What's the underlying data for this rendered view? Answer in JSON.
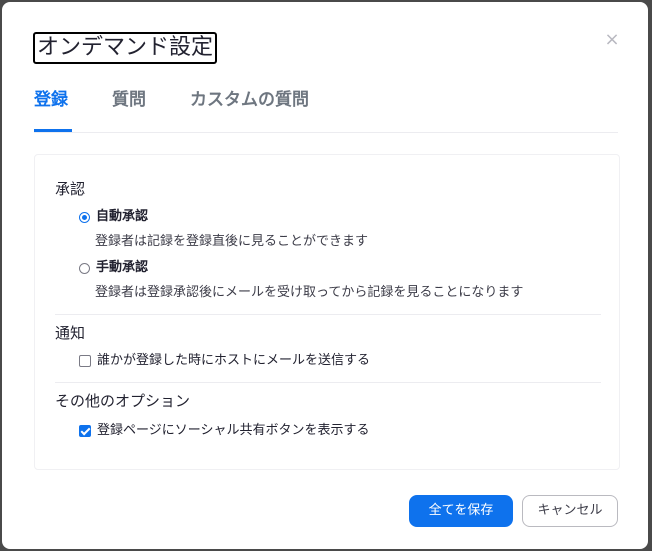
{
  "dialog": {
    "title": "オンデマンド設定",
    "close_glyph": "×"
  },
  "tabs": [
    {
      "label": "登録",
      "active": true
    },
    {
      "label": "質問",
      "active": false
    },
    {
      "label": "カスタムの質問",
      "active": false
    }
  ],
  "approval": {
    "title": "承認",
    "options": [
      {
        "label": "自動承認",
        "description": "登録者は記録を登録直後に見ることができます",
        "selected": true
      },
      {
        "label": "手動承認",
        "description": "登録者は登録承認後にメールを受け取ってから記録を見ることになります",
        "selected": false
      }
    ]
  },
  "notification": {
    "title": "通知",
    "options": [
      {
        "label": "誰かが登録した時にホストにメールを送信する",
        "checked": false
      }
    ]
  },
  "other_options": {
    "title": "その他のオプション",
    "options": [
      {
        "label": "登録ページにソーシャル共有ボタンを表示する",
        "checked": true
      }
    ]
  },
  "footer": {
    "save_label": "全てを保存",
    "cancel_label": "キャンセル"
  },
  "colors": {
    "accent": "#0e72ed",
    "text": "#222230",
    "muted_tab": "#6e7680"
  }
}
